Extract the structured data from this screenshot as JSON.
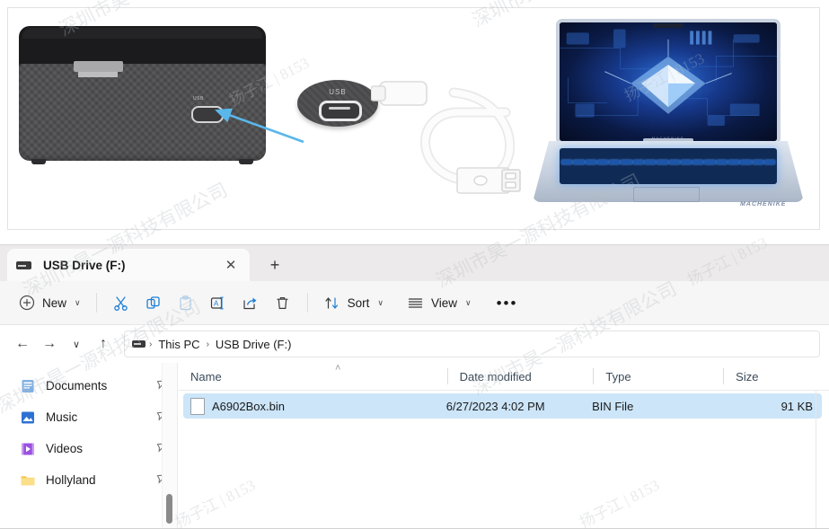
{
  "hero": {
    "device_port_label": "USB",
    "callout_label": "USB",
    "laptop_brand": "MACHENIKE",
    "laptop_logo": "MACHENIKE"
  },
  "window": {
    "tab": {
      "title": "USB Drive (F:)",
      "icon": "usb-drive-icon",
      "close_label": "✕",
      "new_tab_label": "+"
    }
  },
  "toolbar": {
    "new_label": "New",
    "new_icon": "plus-circle-icon",
    "cut_icon": "scissors-icon",
    "copy_icon": "copy-icon",
    "paste_icon": "paste-icon",
    "rename_icon": "rename-icon",
    "share_icon": "share-icon",
    "delete_icon": "trash-icon",
    "sort_label": "Sort",
    "sort_icon": "sort-arrows-icon",
    "view_label": "View",
    "view_icon": "view-lines-icon",
    "more_label": "•••",
    "chevron": "∨"
  },
  "navbar": {
    "back_icon": "←",
    "forward_icon": "→",
    "recent_icon": "∨",
    "up_icon": "↑",
    "breadcrumb": {
      "icon": "usb-drive-icon",
      "items": [
        "This PC",
        "USB Drive (F:)"
      ],
      "separator": "›"
    }
  },
  "sidebar": {
    "items": [
      {
        "label": "Documents",
        "icon": "documents-icon",
        "color": "#6aa0d8",
        "pinned": true
      },
      {
        "label": "Music",
        "icon": "music-icon",
        "color": "#2d72d2",
        "pinned": true
      },
      {
        "label": "Videos",
        "icon": "videos-icon",
        "color": "#8a4fd8",
        "pinned": true
      },
      {
        "label": "Hollyland",
        "icon": "folder-icon",
        "color": "#f2c94c",
        "pinned": true
      }
    ]
  },
  "filelist": {
    "columns": [
      "Name",
      "Date modified",
      "Type",
      "Size"
    ],
    "sort_column": "Name",
    "sort_direction": "ascending",
    "sort_caret": "˄",
    "rows": [
      {
        "name": "A6902Box.bin",
        "date_modified": "6/27/2023 4:02 PM",
        "type": "BIN File",
        "size": "91 KB",
        "selected": true,
        "icon": "file-icon"
      }
    ]
  },
  "colors": {
    "selection": "#cce5f9",
    "accent": "#0f7bd8",
    "tabstrip": "#eceaea",
    "commandbar": "#f6f6f6"
  },
  "watermark": {
    "text_a": "深圳市昊一源科技有限公司",
    "text_b": "扬子江 | 8153"
  }
}
